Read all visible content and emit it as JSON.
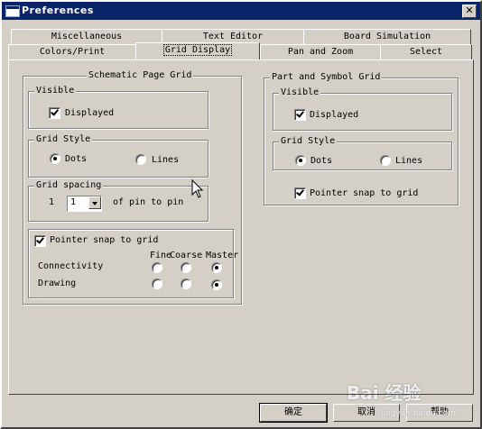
{
  "window": {
    "title": "Preferences",
    "close_glyph": "✕"
  },
  "tabs": {
    "row1": [
      {
        "label": "Miscellaneous"
      },
      {
        "label": "Text Editor"
      },
      {
        "label": "Board Simulation"
      }
    ],
    "row2": [
      {
        "label": "Colors/Print"
      },
      {
        "label": "Grid Display",
        "active": true
      },
      {
        "label": "Pan and Zoom"
      },
      {
        "label": "Select"
      }
    ]
  },
  "schematic": {
    "title": "Schematic Page Grid",
    "visible": {
      "title": "Visible",
      "displayed_label": "Displayed",
      "displayed": true
    },
    "grid_style": {
      "title": "Grid Style",
      "dots_label": "Dots",
      "lines_label": "Lines",
      "selected": "Dots"
    },
    "grid_spacing": {
      "title": "Grid spacing",
      "prefix": "1",
      "value": "1",
      "suffix": "of pin to pin"
    },
    "snap": {
      "pointer_label": "Pointer snap to grid",
      "checked": true,
      "columns": [
        "Fine",
        "Coarse",
        "Master"
      ],
      "rows": [
        {
          "label": "Connectivity",
          "selected": "Master"
        },
        {
          "label": "Drawing",
          "selected": "Master"
        }
      ]
    }
  },
  "part_symbol": {
    "title": "Part and Symbol Grid",
    "visible": {
      "title": "Visible",
      "displayed_label": "Displayed",
      "displayed": true
    },
    "grid_style": {
      "title": "Grid Style",
      "dots_label": "Dots",
      "lines_label": "Lines",
      "selected": "Dots"
    },
    "pointer_label": "Pointer snap to grid",
    "pointer_checked": true
  },
  "buttons": {
    "ok": "确定",
    "cancel": "取消",
    "help": "帮助"
  },
  "watermark": {
    "main": "Bai 经验",
    "sub": "jingyan.baidu.com"
  }
}
